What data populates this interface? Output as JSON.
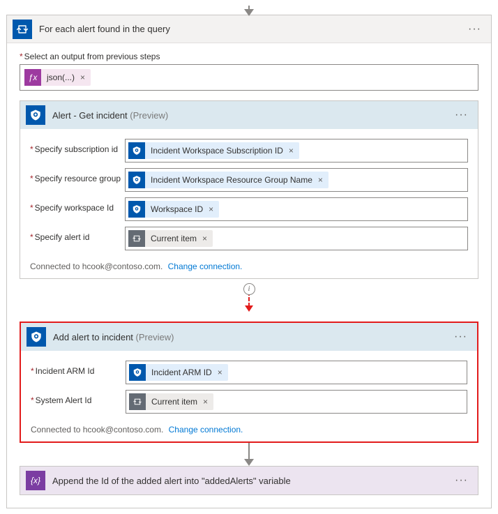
{
  "loop": {
    "title": "For each alert found in the query",
    "output_label": "Select an output from previous steps"
  },
  "tokens": {
    "json": "json(...)",
    "sub": "Incident Workspace Subscription ID",
    "rg": "Incident Workspace Resource Group Name",
    "ws": "Workspace ID",
    "cur": "Current item",
    "arm": "Incident ARM ID"
  },
  "getIncident": {
    "title": "Alert - Get incident",
    "preview": "(Preview)",
    "fields": {
      "sub": "Specify subscription id",
      "rg": "Specify resource group",
      "ws": "Specify workspace Id",
      "alert": "Specify alert id"
    }
  },
  "addAlert": {
    "title": "Add alert to incident",
    "preview": "(Preview)",
    "fields": {
      "arm": "Incident ARM Id",
      "sys": "System Alert Id"
    }
  },
  "connection": {
    "text": "Connected to hcook@contoso.com.",
    "link": "Change connection."
  },
  "append": {
    "title": "Append the Id of the added alert into \"addedAlerts\" variable"
  }
}
